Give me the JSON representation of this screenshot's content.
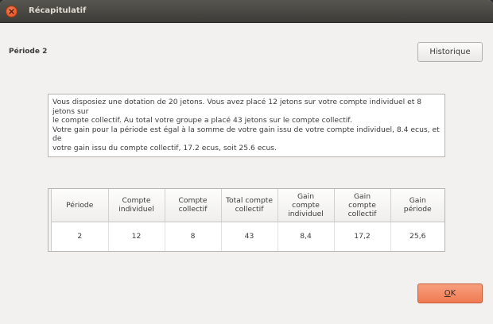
{
  "window": {
    "title": "Récapitulatif"
  },
  "header": {
    "period_label": "Période 2",
    "history_button": "Historique"
  },
  "summary": {
    "lines": [
      "Vous disposiez une dotation de 20 jetons. Vous avez placé 12 jetons sur votre compte individuel et 8 jetons sur",
      "le compte collectif. Au total votre groupe a placé 43 jetons sur le compte collectif.",
      "Votre gain pour la période est égal à la somme de votre gain issu de votre compte individuel, 8.4 ecus, et de",
      "votre gain issu du compte collectif, 17.2 ecus, soit 25.6 ecus."
    ]
  },
  "table": {
    "columns": [
      [
        "Période"
      ],
      [
        "Compte",
        "individuel"
      ],
      [
        "Compte",
        "collectif"
      ],
      [
        "Total compte",
        "collectif"
      ],
      [
        "Gain",
        "compte",
        "individuel"
      ],
      [
        "Gain",
        "compte",
        "collectif"
      ],
      [
        "Gain",
        "période"
      ]
    ],
    "rows": [
      [
        "2",
        "12",
        "8",
        "43",
        "8,4",
        "17,2",
        "25,6"
      ]
    ]
  },
  "footer": {
    "ok_prefix": "",
    "ok_mnemonic": "O",
    "ok_rest": "K"
  }
}
